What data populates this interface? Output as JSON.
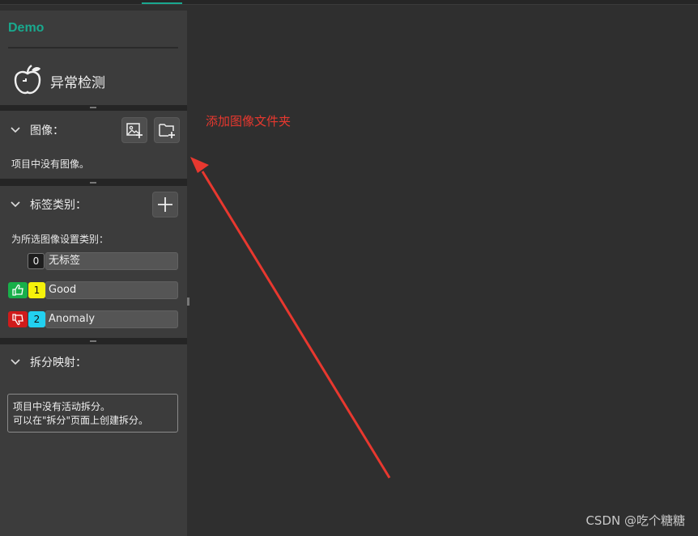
{
  "app": {
    "project_name": "Demo",
    "title": "异常检测"
  },
  "images_section": {
    "title": "图像：",
    "empty_text": "项目中没有图像。",
    "add_image_icon": "add-image-icon",
    "add_folder_icon": "add-folder-icon"
  },
  "labels_section": {
    "title": "标签类别：",
    "hint": "为所选图像设置类别：",
    "add_icon": "plus-icon",
    "items": [
      {
        "index": "0",
        "name": "无标签",
        "badge_color": "#1e1e1e"
      },
      {
        "index": "1",
        "name": "Good",
        "badge_color": "#f6f20a",
        "thumb_color": "#18b04a"
      },
      {
        "index": "2",
        "name": "Anomaly",
        "badge_color": "#22d0f0",
        "thumb_color": "#d01b1b"
      }
    ]
  },
  "split_section": {
    "title": "拆分映射：",
    "info_line1": "项目中没有活动拆分。",
    "info_line2": "可以在\"拆分\"页面上创建拆分。"
  },
  "annotation": {
    "text": "添加图像文件夹",
    "color": "#e8382f"
  },
  "watermark": {
    "text": "CSDN @吃个糖糖"
  },
  "colors": {
    "accent": "#19a98e",
    "panel": "#3c3c3c",
    "background": "#2f2f2f"
  }
}
